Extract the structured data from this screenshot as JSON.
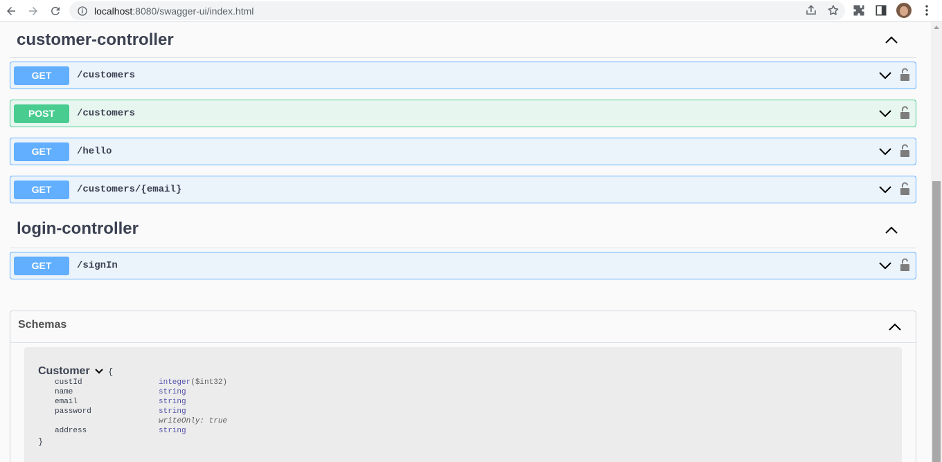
{
  "browser": {
    "url_host": "localhost",
    "url_rest": ":8080/swagger-ui/index.html"
  },
  "tags": [
    {
      "name": "customer-controller",
      "operations": [
        {
          "method": "GET",
          "path": "/customers"
        },
        {
          "method": "POST",
          "path": "/customers"
        },
        {
          "method": "GET",
          "path": "/hello"
        },
        {
          "method": "GET",
          "path": "/customers/{email}"
        }
      ]
    },
    {
      "name": "login-controller",
      "operations": [
        {
          "method": "GET",
          "path": "/signIn"
        }
      ]
    }
  ],
  "schemas": {
    "title": "Schemas",
    "model": {
      "name": "Customer",
      "open_brace": "{",
      "close_brace": "}",
      "properties": [
        {
          "name": "custId",
          "type": "integer",
          "format": "($int32)"
        },
        {
          "name": "name",
          "type": "string"
        },
        {
          "name": "email",
          "type": "string"
        },
        {
          "name": "password",
          "type": "string",
          "note": "writeOnly: true"
        },
        {
          "name": "address",
          "type": "string"
        }
      ]
    }
  },
  "colors": {
    "get": "#61affe",
    "post": "#49cc90",
    "text": "#3b4151"
  }
}
